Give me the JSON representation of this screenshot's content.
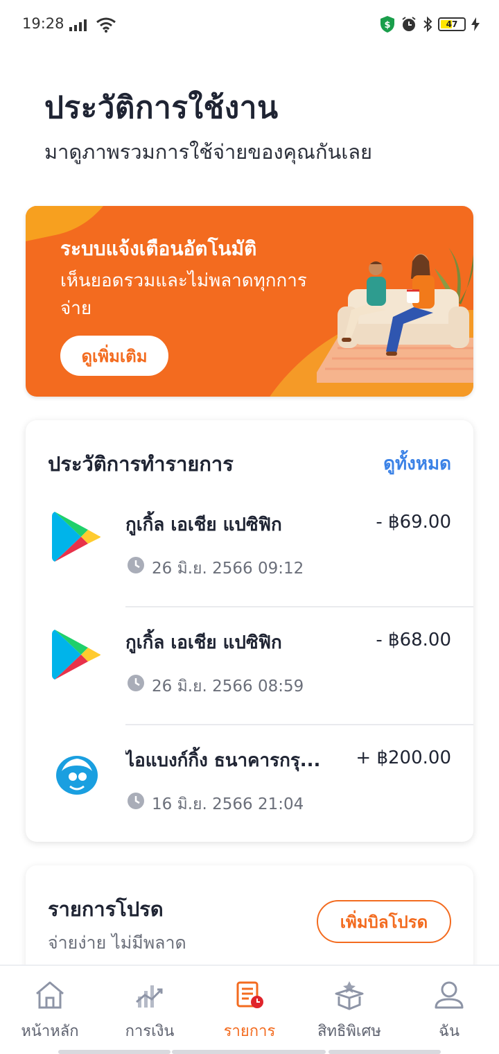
{
  "status_bar": {
    "time": "19:28",
    "battery": "47"
  },
  "header": {
    "title": "ประวัติการใช้งาน",
    "subtitle": "มาดูภาพรวมการใช้จ่ายของคุณกันเลย"
  },
  "banner": {
    "title": "ระบบแจ้งเตือนอัตโนมัติ",
    "text": "เห็นยอดรวมและไม่พลาดทุกการจ่าย",
    "button": "ดูเพิ่มเติม"
  },
  "transactions": {
    "title": "ประวัติการทำรายการ",
    "view_all": "ดูทั้งหมด",
    "items": [
      {
        "name": "กูเกิ้ล เอเชีย แปซิฟิก",
        "amount": "- ฿69.00",
        "date": "26 มิ.ย. 2566 09:12",
        "icon": "google-play-icon"
      },
      {
        "name": "กูเกิ้ล เอเชีย แปซิฟิก",
        "amount": "- ฿68.00",
        "date": "26 มิ.ย. 2566 08:59",
        "icon": "google-play-icon"
      },
      {
        "name": "ไอแบงก์กิ้ง  ธนาคารกรุ...",
        "amount": "+ ฿200.00",
        "date": "16 มิ.ย. 2566 21:04",
        "icon": "kbank-icon"
      }
    ]
  },
  "scheduled": {
    "title": "รายการโปรด",
    "subtitle": "จ่ายง่าย ไม่มีพลาด",
    "button": "เพิ่มบิลโปรด"
  },
  "nav": {
    "items": [
      {
        "label": "หน้าหลัก",
        "icon": "home-icon"
      },
      {
        "label": "การเงิน",
        "icon": "finance-chart-icon"
      },
      {
        "label": "รายการ",
        "icon": "transactions-icon",
        "active": true
      },
      {
        "label": "สิทธิพิเศษ",
        "icon": "privilege-box-icon"
      },
      {
        "label": "ฉัน",
        "icon": "profile-icon"
      }
    ]
  },
  "colors": {
    "accent": "#f36b1f",
    "link": "#3b82e6",
    "text": "#1f2433"
  }
}
